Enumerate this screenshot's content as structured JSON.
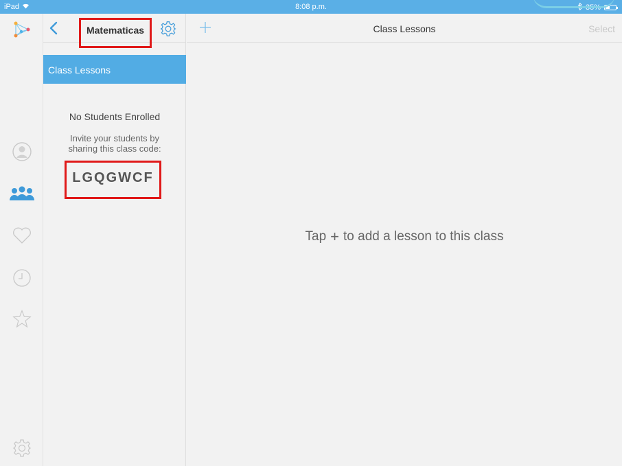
{
  "status_bar": {
    "device": "iPad",
    "time": "8:08 p.m.",
    "battery": "35%"
  },
  "class_panel": {
    "title": "Matematicas",
    "lessons_item": "Class Lessons",
    "no_students": "No Students Enrolled",
    "invite_text": "Invite your students by sharing this class code:",
    "class_code": "LGQGWCF"
  },
  "main": {
    "title": "Class Lessons",
    "select_label": "Select",
    "empty_hint_prefix": "Tap",
    "empty_hint_plus": "+",
    "empty_hint_suffix": "to add a lesson to this class"
  },
  "icons": {
    "rail": [
      "app-logo-icon",
      "profile-icon",
      "classes-icon",
      "favorites-icon",
      "history-icon",
      "starred-icon",
      "settings-icon"
    ],
    "header": [
      "back-chevron-icon",
      "gear-icon",
      "plus-icon"
    ]
  },
  "colors": {
    "status_bar": "#5aafe6",
    "accent": "#52ace4",
    "highlight_box": "#e01919",
    "background": "#f2f2f2"
  }
}
